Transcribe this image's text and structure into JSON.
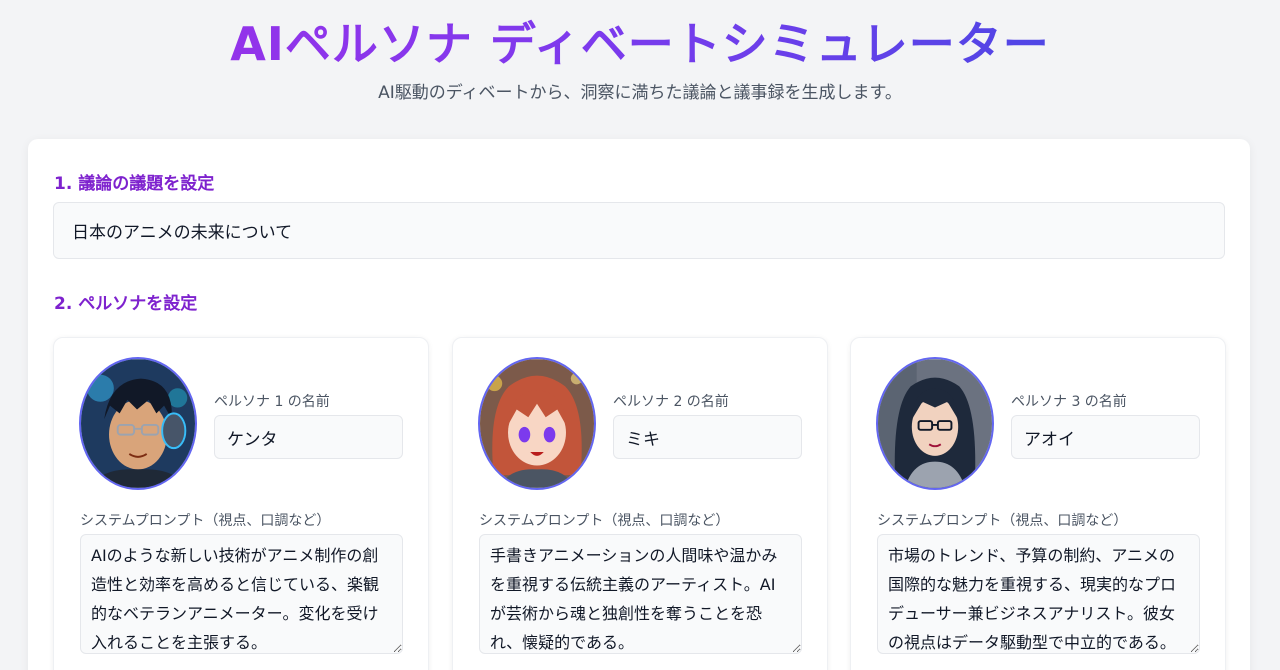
{
  "header": {
    "title": "AIペルソナ ディベートシミュレーター",
    "subtitle": "AI駆動のディベートから、洞察に満ちた議論と議事録を生成します。"
  },
  "topic_section": {
    "label": "1. 議論の議題を設定",
    "value": "日本のアニメの未来について"
  },
  "persona_section": {
    "label": "2. ペルソナを設定",
    "personas": [
      {
        "name_label": "ペルソナ 1 の名前",
        "name": "ケンタ",
        "prompt_label": "システムプロンプト（視点、口調など）",
        "prompt": "AIのような新しい技術がアニメ制作の創造性と効率を高めると信じている、楽観的なベテランアニメーター。変化を受け入れることを主張する。"
      },
      {
        "name_label": "ペルソナ 2 の名前",
        "name": "ミキ",
        "prompt_label": "システムプロンプト（視点、口調など）",
        "prompt": "手書きアニメーションの人間味や温かみを重視する伝統主義のアーティスト。AIが芸術から魂と独創性を奪うことを恐れ、懐疑的である。"
      },
      {
        "name_label": "ペルソナ 3 の名前",
        "name": "アオイ",
        "prompt_label": "システムプロンプト（視点、口調など）",
        "prompt": "市場のトレンド、予算の制約、アニメの国際的な魅力を重視する、現実的なプロデューサー兼ビジネスアナリスト。彼女の視点はデータ駆動型で中立的である。"
      }
    ]
  },
  "colors": {
    "accent_purple": "#7e22ce",
    "avatar_border": "#6366f1",
    "title_gradient_start": "#9333ea",
    "title_gradient_end": "#4f46e5"
  }
}
